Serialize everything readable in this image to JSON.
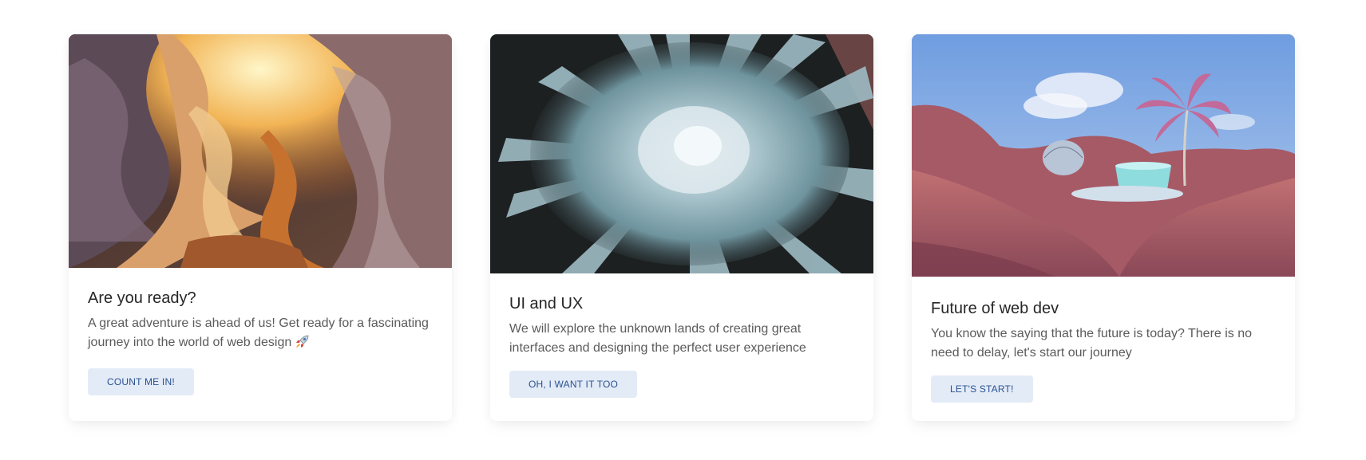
{
  "cards": [
    {
      "image_alt": "canyon-photo",
      "title": "Are you ready?",
      "text": "A great adventure is ahead of us! Get ready for a fascinating journey into the world of web design",
      "emoji_icon": "rocket-icon",
      "button_label": "Count me in!"
    },
    {
      "image_alt": "abstract-burst-photo",
      "title": "UI and UX",
      "text": "We will explore the unknown lands of creating great interfaces and designing the perfect user experience",
      "button_label": "Oh, I want it too"
    },
    {
      "image_alt": "pink-landscape-photo",
      "title": "Future of web dev",
      "text": "You know the saying that the future is today? There is no need to delay, let's start our journey",
      "button_label": "Let's start!"
    }
  ],
  "colors": {
    "button_bg": "#e3ebf7",
    "button_text": "#285192",
    "title_text": "#262626",
    "body_text": "#5b5b5b"
  }
}
